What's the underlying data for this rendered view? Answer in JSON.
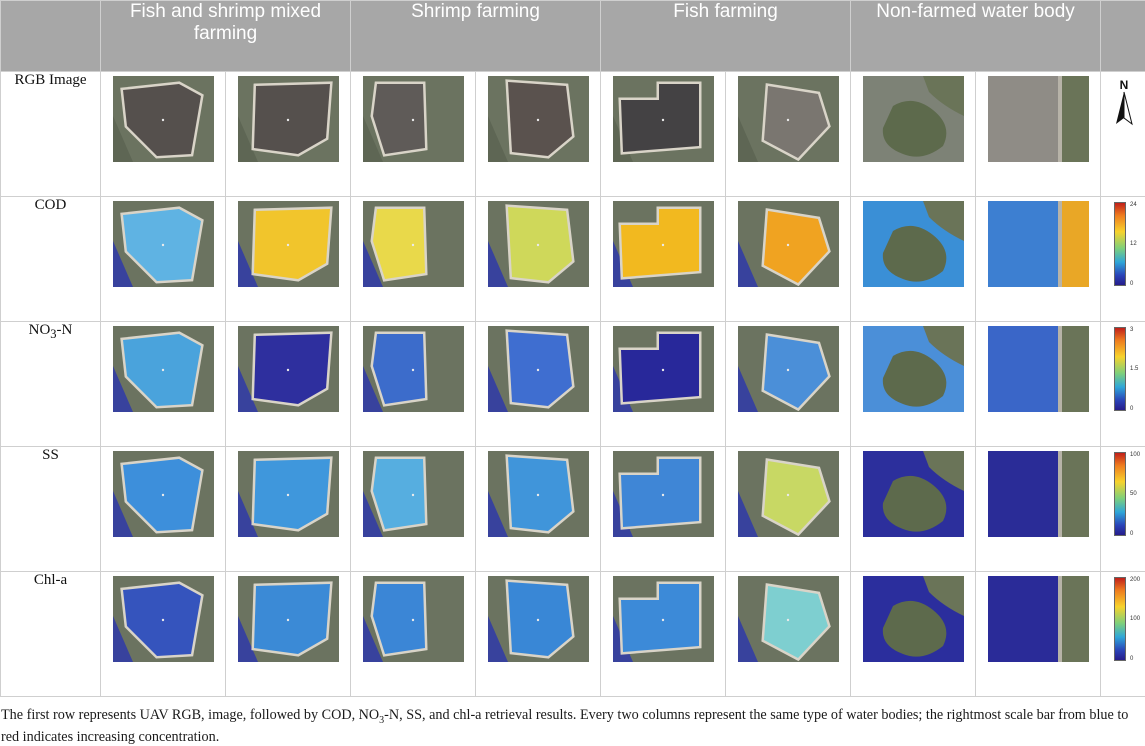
{
  "header": {
    "columns": [
      "Fish and shrimp mixed farming",
      "Shrimp farming",
      "Fish farming",
      "Non-farmed water body"
    ]
  },
  "rows": [
    {
      "label": "RGB Image",
      "kind": "rgb"
    },
    {
      "label": "COD",
      "kind": "cod"
    },
    {
      "label": "NO",
      "sub": "3",
      "suffix": "-N",
      "kind": "no3"
    },
    {
      "label": "SS",
      "kind": "ss"
    },
    {
      "label": "Chl-a",
      "kind": "chl"
    }
  ],
  "legend": {
    "north_label": "N",
    "scales": [
      {
        "top": "24",
        "mid": "12",
        "bottom": "0"
      },
      {
        "top": "3",
        "mid": "1.5",
        "bottom": "0"
      },
      {
        "top": "100",
        "mid": "50",
        "bottom": "0"
      },
      {
        "top": "200",
        "mid": "100",
        "bottom": "0"
      }
    ]
  },
  "colors": {
    "header_bg": "#a7a7a7",
    "water_rgb": "#55504d",
    "cod_high": "#f1c52c",
    "cod_low": "#5fb3e3",
    "deep_blue": "#2e2f9e",
    "mid_blue": "#3d7fd1",
    "land": "#6b7360"
  },
  "caption": {
    "part1": "The first row represents UAV RGB, image, followed by COD, NO",
    "sub": "3",
    "part2": "-N, SS, and chl-a retrieval results. Every two columns represent the same type of water bodies; the rightmost scale bar from blue to red indicates increasing concentration."
  }
}
